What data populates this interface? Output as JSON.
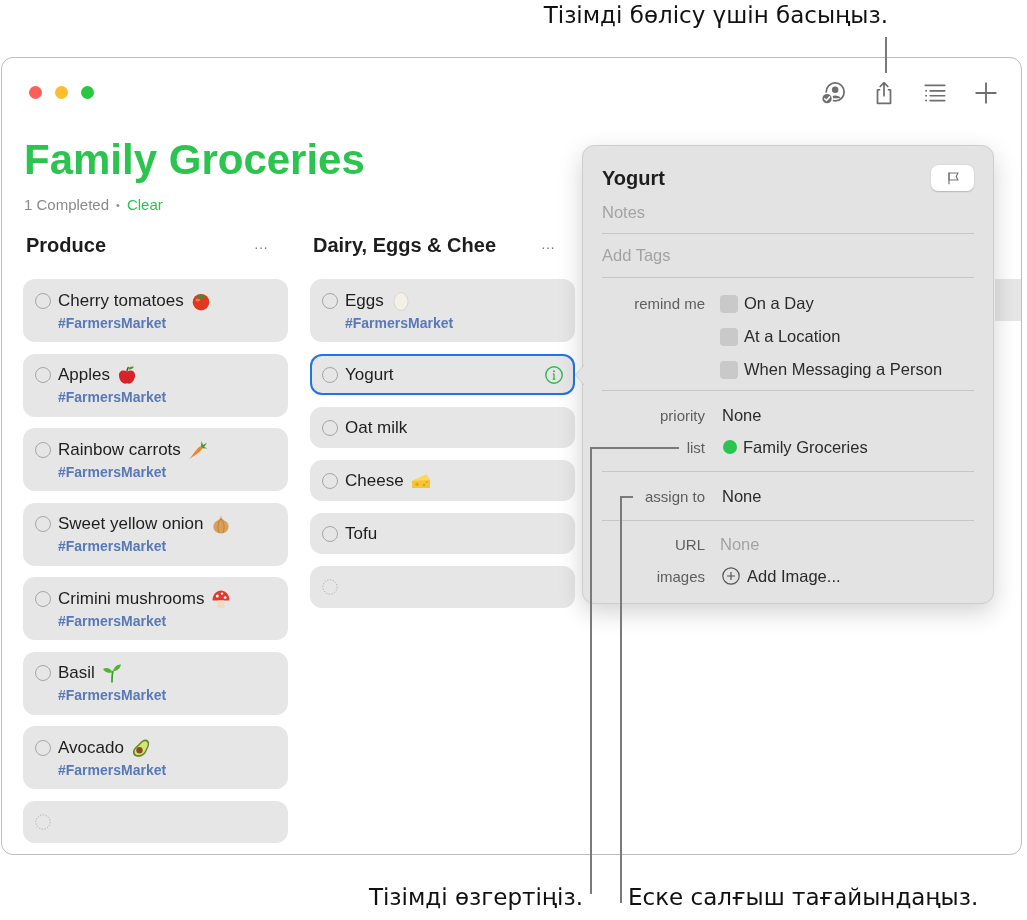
{
  "annotations": [
    {
      "text": "Тізімді бөлісу үшін басыңыз."
    },
    {
      "text": "Тізімді өзгертіңіз."
    },
    {
      "text": "Еске салғыш тағайындаңыз."
    }
  ],
  "window": {
    "title": "Family Groceries",
    "completed": "1 Completed",
    "separator": "•",
    "clear": "Clear"
  },
  "columns": [
    {
      "title": "Produce",
      "menu": "···",
      "items": [
        {
          "name": "Cherry tomatoes",
          "tag": "#FarmersMarket",
          "completed": false,
          "selected": false
        },
        {
          "name": "Apples",
          "tag": "#FarmersMarket",
          "completed": false,
          "selected": false
        },
        {
          "name": "Rainbow carrots",
          "tag": "#FarmersMarket",
          "completed": false,
          "selected": false
        },
        {
          "name": "Sweet yellow onion",
          "tag": "#FarmersMarket",
          "completed": false,
          "selected": false
        },
        {
          "name": "Crimini mushrooms",
          "tag": "#FarmersMarket",
          "completed": false,
          "selected": false
        },
        {
          "name": "Basil",
          "tag": "#FarmersMarket",
          "completed": false,
          "selected": false
        },
        {
          "name": "Avocado",
          "tag": "#FarmersMarket",
          "completed": false,
          "selected": false
        }
      ]
    },
    {
      "title": "Dairy, Eggs & Chee",
      "menu": "···",
      "items": [
        {
          "name": "Eggs",
          "tag": "#FarmersMarket",
          "completed": false,
          "selected": false
        },
        {
          "name": "Yogurt",
          "completed": false,
          "selected": true
        },
        {
          "name": "Oat milk",
          "completed": false,
          "selected": false
        },
        {
          "name": "Cheese",
          "completed": false,
          "selected": false
        },
        {
          "name": "Tofu",
          "completed": false,
          "selected": false
        }
      ]
    }
  ],
  "inspector": {
    "title": "Yogurt",
    "flagged": false,
    "notes_placeholder": "Notes",
    "tags_placeholder": "Add Tags",
    "remind_me": {
      "label": "remind me",
      "options": [
        {
          "label": "On a Day",
          "checked": false
        },
        {
          "label": "At a Location",
          "checked": false
        },
        {
          "label": "When Messaging a Person",
          "checked": false
        }
      ]
    },
    "sections": [
      [
        {
          "kind": "value",
          "label": "priority",
          "value": "None"
        },
        {
          "kind": "list",
          "label": "list",
          "value": "Family Groceries",
          "color": "#2bc44e"
        }
      ],
      [
        {
          "kind": "value",
          "label": "assign to",
          "value": "None"
        }
      ],
      [
        {
          "kind": "field",
          "label": "URL",
          "placeholder": "None"
        },
        {
          "kind": "action",
          "label": "images",
          "action": "Add Image..."
        }
      ]
    ]
  }
}
